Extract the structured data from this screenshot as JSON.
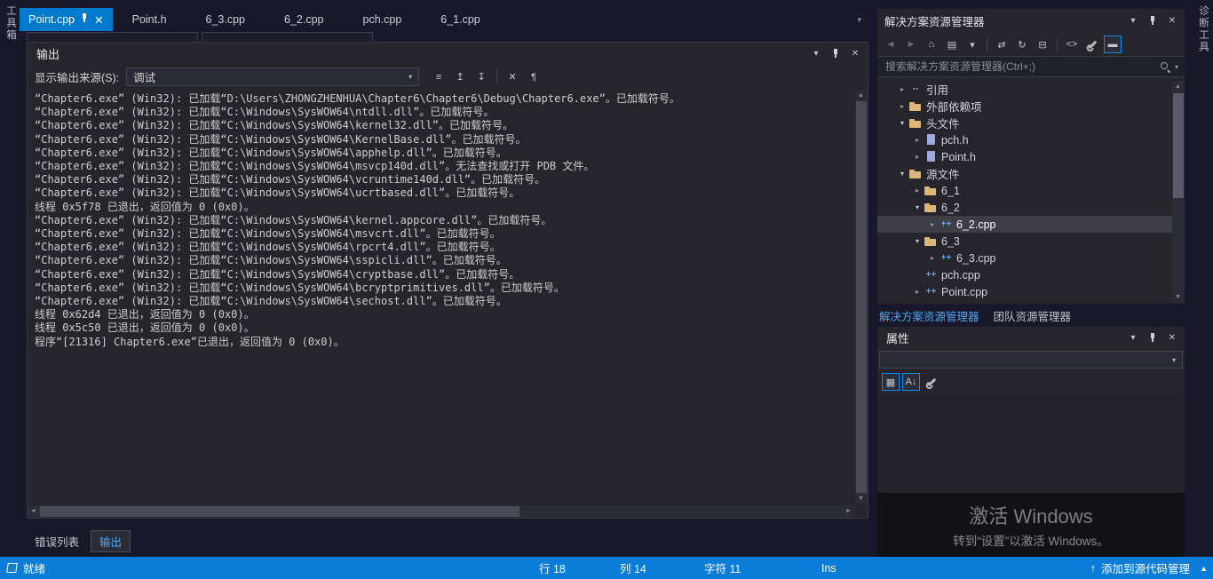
{
  "colors": {
    "accent": "#007acc",
    "chrome": "#18182a",
    "panel": "#25252b",
    "selection": "#3e3e46",
    "status_bar": "#0b7cd8",
    "folder_icon": "#dcb67a",
    "active_link": "#4ea6f2"
  },
  "left_strip": {
    "label": "工具箱"
  },
  "right_strip": {
    "label": "诊断工具"
  },
  "editor_tabs": [
    {
      "name": "tab-point-cpp",
      "label": "Point.cpp",
      "active": true
    },
    {
      "name": "tab-point-h",
      "label": "Point.h"
    },
    {
      "name": "tab-6-3-cpp",
      "label": "6_3.cpp"
    },
    {
      "name": "tab-6-2-cpp",
      "label": "6_2.cpp"
    },
    {
      "name": "tab-pch-cpp",
      "label": "pch.cpp"
    },
    {
      "name": "tab-6-1-cpp",
      "label": "6_1.cpp"
    }
  ],
  "output": {
    "title": "输出",
    "source_label": "显示输出来源(S):",
    "source_value": "调试",
    "toolbar_icons": [
      {
        "name": "find-message-icon",
        "glyph": "≡"
      },
      {
        "name": "previous-message-icon",
        "glyph": "↥"
      },
      {
        "name": "next-message-icon",
        "glyph": "↧"
      },
      {
        "name": "separator"
      },
      {
        "name": "clear-all-icon",
        "glyph": "✕"
      },
      {
        "name": "word-wrap-icon",
        "glyph": "¶"
      }
    ],
    "lines": [
      "“Chapter6.exe” (Win32): 已加载“D:\\Users\\ZHONGZHENHUA\\Chapter6\\Chapter6\\Debug\\Chapter6.exe”。已加载符号。",
      "“Chapter6.exe” (Win32): 已加载“C:\\Windows\\SysWOW64\\ntdll.dll”。已加载符号。",
      "“Chapter6.exe” (Win32): 已加载“C:\\Windows\\SysWOW64\\kernel32.dll”。已加载符号。",
      "“Chapter6.exe” (Win32): 已加载“C:\\Windows\\SysWOW64\\KernelBase.dll”。已加载符号。",
      "“Chapter6.exe” (Win32): 已加载“C:\\Windows\\SysWOW64\\apphelp.dll”。已加载符号。",
      "“Chapter6.exe” (Win32): 已加载“C:\\Windows\\SysWOW64\\msvcp140d.dll”。无法查找或打开 PDB 文件。",
      "“Chapter6.exe” (Win32): 已加载“C:\\Windows\\SysWOW64\\vcruntime140d.dll”。已加载符号。",
      "“Chapter6.exe” (Win32): 已加载“C:\\Windows\\SysWOW64\\ucrtbased.dll”。已加载符号。",
      "线程 0x5f78 已退出，返回值为 0 (0x0)。",
      "“Chapter6.exe” (Win32): 已加载“C:\\Windows\\SysWOW64\\kernel.appcore.dll”。已加载符号。",
      "“Chapter6.exe” (Win32): 已加载“C:\\Windows\\SysWOW64\\msvcrt.dll”。已加载符号。",
      "“Chapter6.exe” (Win32): 已加载“C:\\Windows\\SysWOW64\\rpcrt4.dll”。已加载符号。",
      "“Chapter6.exe” (Win32): 已加载“C:\\Windows\\SysWOW64\\sspicli.dll”。已加载符号。",
      "“Chapter6.exe” (Win32): 已加载“C:\\Windows\\SysWOW64\\cryptbase.dll”。已加载符号。",
      "“Chapter6.exe” (Win32): 已加载“C:\\Windows\\SysWOW64\\bcryptprimitives.dll”。已加载符号。",
      "“Chapter6.exe” (Win32): 已加载“C:\\Windows\\SysWOW64\\sechost.dll”。已加载符号。",
      "线程 0x62d4 已退出，返回值为 0 (0x0)。",
      "线程 0x5c50 已退出，返回值为 0 (0x0)。",
      "程序“[21316] Chapter6.exe”已退出，返回值为 0 (0x0)。"
    ],
    "bottom_tabs": [
      {
        "name": "error-list-tab",
        "label": "错误列表",
        "active": false
      },
      {
        "name": "output-tab",
        "label": "输出",
        "active": true
      }
    ]
  },
  "solution_explorer": {
    "title": "解决方案资源管理器",
    "search_placeholder": "搜索解决方案资源管理器(Ctrl+;)",
    "toolbar_icons": [
      {
        "name": "back-icon",
        "glyph": "◄",
        "dim": true
      },
      {
        "name": "forward-icon",
        "glyph": "►",
        "dim": true
      },
      {
        "name": "home-icon",
        "glyph": "⌂"
      },
      {
        "name": "switch-views-icon",
        "glyph": "▤"
      },
      {
        "name": "views-dropdown-icon",
        "glyph": "▾"
      },
      {
        "name": "separator"
      },
      {
        "name": "sync-with-active-document-icon",
        "glyph": "⇄"
      },
      {
        "name": "refresh-icon",
        "glyph": "↻"
      },
      {
        "name": "collapse-all-icon",
        "glyph": "⊟"
      },
      {
        "name": "separator"
      },
      {
        "name": "view-code-icon",
        "glyph": "<>"
      },
      {
        "name": "properties-icon",
        "glyph": "css-wrench"
      },
      {
        "name": "preview-selected-icon",
        "glyph": "▬",
        "boxed": true
      }
    ],
    "tree": [
      {
        "name": "tree-item-references",
        "depth": 1,
        "expander": "collapsed",
        "icon": "references-icon",
        "label": "引用"
      },
      {
        "name": "tree-item-external-dependencies",
        "depth": 1,
        "expander": "collapsed",
        "icon": "external-deps-icon",
        "label": "外部依赖项"
      },
      {
        "name": "tree-item-header-files",
        "depth": 1,
        "expander": "expanded",
        "icon": "folder-icon",
        "label": "头文件"
      },
      {
        "name": "tree-item-pch-h",
        "depth": 2,
        "expander": "collapsed",
        "icon": "header-file-icon",
        "label": "pch.h"
      },
      {
        "name": "tree-item-point-h",
        "depth": 2,
        "expander": "collapsed",
        "icon": "header-file-icon",
        "label": "Point.h"
      },
      {
        "name": "tree-item-source-files",
        "depth": 1,
        "expander": "expanded",
        "icon": "folder-icon",
        "label": "源文件"
      },
      {
        "name": "tree-item-6-1",
        "depth": 2,
        "expander": "collapsed",
        "icon": "filter-icon",
        "label": "6_1"
      },
      {
        "name": "tree-item-6-2",
        "depth": 2,
        "expander": "expanded",
        "icon": "filter-icon",
        "label": "6_2"
      },
      {
        "name": "tree-item-6-2-cpp",
        "depth": 3,
        "expander": "collapsed",
        "icon": "cpp-file-icon",
        "label": "6_2.cpp",
        "selected": true
      },
      {
        "name": "tree-item-6-3",
        "depth": 2,
        "expander": "expanded",
        "icon": "filter-icon",
        "label": "6_3"
      },
      {
        "name": "tree-item-6-3-cpp",
        "depth": 3,
        "expander": "collapsed",
        "icon": "cpp-file-icon",
        "label": "6_3.cpp"
      },
      {
        "name": "tree-item-pch-cpp",
        "depth": 2,
        "expander": "none",
        "icon": "cpp-file-icon",
        "label": "pch.cpp"
      },
      {
        "name": "tree-item-point-cpp",
        "depth": 2,
        "expander": "collapsed",
        "icon": "cpp-file-icon",
        "label": "Point.cpp"
      }
    ],
    "bottom_tabs": [
      {
        "name": "solution-explorer-tab",
        "label": "解决方案资源管理器",
        "active": true
      },
      {
        "name": "team-explorer-tab",
        "label": "团队资源管理器",
        "active": false
      }
    ]
  },
  "properties": {
    "title": "属性",
    "toolbar_icons": [
      {
        "name": "categorized-icon",
        "glyph": "▦",
        "boxed": true
      },
      {
        "name": "alphabetical-icon",
        "glyph": "A↓",
        "boxed": true
      },
      {
        "name": "property-pages-icon",
        "glyph": "css-wrench"
      }
    ]
  },
  "watermark": {
    "title": "激活 Windows",
    "subtitle": "转到“设置”以激活 Windows。"
  },
  "status_bar": {
    "ready": "就绪",
    "line": "行 18",
    "column": "列 14",
    "character": "字符 11",
    "insert_mode": "Ins",
    "source_control": "添加到源代码管理"
  }
}
